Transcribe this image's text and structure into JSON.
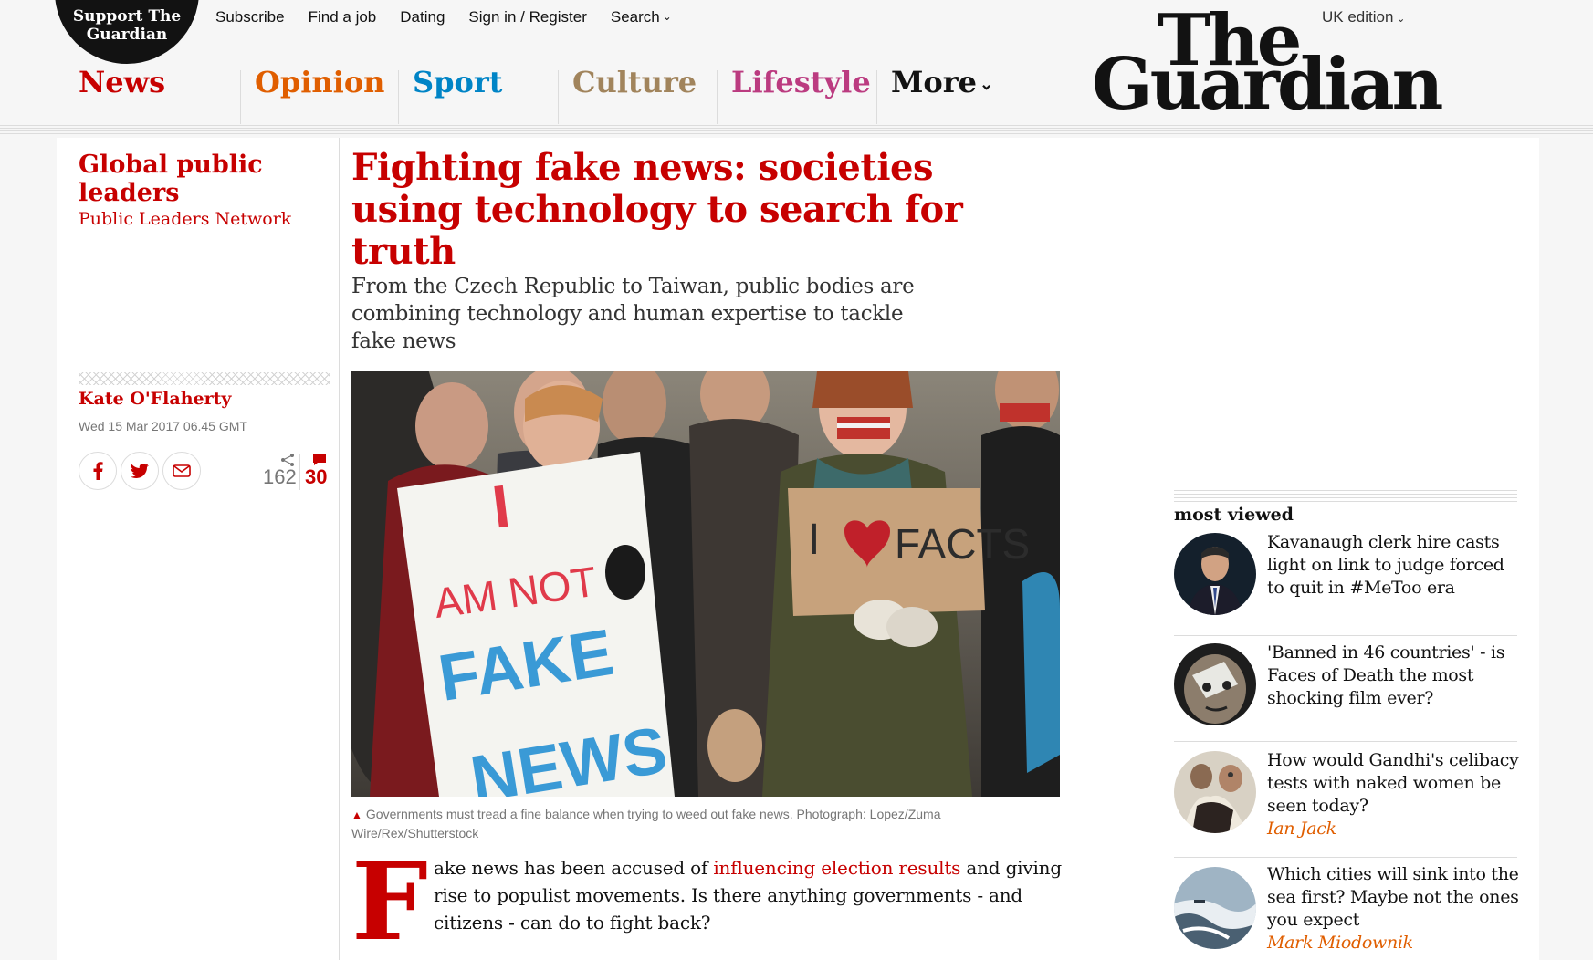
{
  "header": {
    "support_label": "Support The Guardian",
    "top_links": [
      "Subscribe",
      "Find a job",
      "Dating",
      "Sign in / Register",
      "Search"
    ],
    "edition": "UK edition",
    "logo_line1": "The",
    "logo_line2": "Guardian",
    "pillars": {
      "news": "News",
      "opinion": "Opinion",
      "sport": "Sport",
      "culture": "Culture",
      "lifestyle": "Lifestyle",
      "more": "More"
    },
    "colors": {
      "news": "#c70000",
      "opinion": "#e05e00",
      "sport": "#0084c6",
      "culture": "#a1845c",
      "lifestyle": "#bb3b80"
    }
  },
  "section": {
    "title": "Global public leaders",
    "subtitle": "Public Leaders Network"
  },
  "meta": {
    "author": "Kate O'Flaherty",
    "date": "Wed 15 Mar 2017 06.45 GMT",
    "share_count": "162",
    "comment_count": "30",
    "share_icons": [
      "facebook-icon",
      "twitter-icon",
      "email-icon"
    ]
  },
  "article": {
    "headline": "Fighting fake news: societies using technology to search for truth",
    "standfirst": "From the Czech Republic to Taiwan, public bodies are combining technology and human expertise to tackle fake news",
    "image_sign_left": [
      "I",
      "AM NOT",
      "FAKE",
      "NEWS"
    ],
    "image_sign_right": [
      "I",
      "FACTS"
    ],
    "caption": "Governments must tread a fine balance when trying to weed out fake news. Photograph: Lopez/Zuma Wire/Rex/Shutterstock",
    "dropcap": "F",
    "body_before_link": "ake news has been accused of ",
    "body_link": "influencing election results",
    "body_after_link": " and giving rise to populist movements. Is there anything governments - and citizens - can do to fight back?"
  },
  "most_viewed": {
    "title": "most viewed",
    "items": [
      {
        "headline": "Kavanaugh clerk hire casts light on link to judge forced to quit in #MeToo era",
        "author": ""
      },
      {
        "headline": "'Banned in 46 countries' - is Faces of Death the most shocking film ever?",
        "author": ""
      },
      {
        "headline": "How would Gandhi's celibacy tests with naked women be seen today?",
        "author": "Ian Jack"
      },
      {
        "headline": "Which cities will sink into the sea first? Maybe not the ones you expect",
        "author": "Mark Miodownik"
      }
    ]
  }
}
